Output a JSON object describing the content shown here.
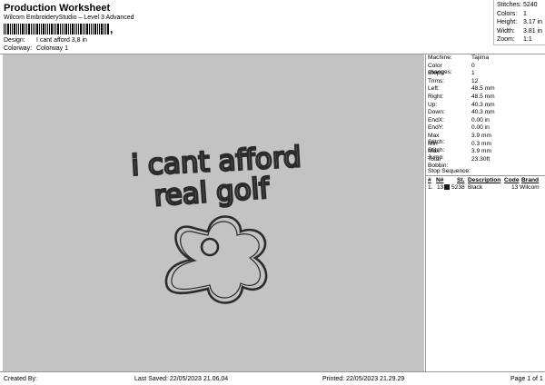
{
  "header": {
    "title": "Production Worksheet",
    "subtitle": "Wilcom EmbroideryStudio – Level 3 Advanced",
    "barcode_suffix": ","
  },
  "meta": [
    {
      "label": "Design:",
      "value": "I cant afford 3,8 in"
    },
    {
      "label": "Colorway:",
      "value": "Colorway 1"
    }
  ],
  "stats": [
    {
      "label": "Stitches:",
      "value": "5240"
    },
    {
      "label": "Colors:",
      "value": "1"
    },
    {
      "label": "Height:",
      "value": "3.17 in"
    },
    {
      "label": "Width:",
      "value": "3.81 in"
    },
    {
      "label": "Zoom:",
      "value": "1:1"
    }
  ],
  "machine": [
    {
      "label": "Machine:",
      "value": "Tajima"
    },
    {
      "label": "Color changes:",
      "value": "0"
    },
    {
      "label": "Stops:",
      "value": "1"
    },
    {
      "label": "Trims:",
      "value": "12"
    },
    {
      "label": "Left:",
      "value": "48.5 mm"
    },
    {
      "label": "Right:",
      "value": "48.5 mm"
    },
    {
      "label": "Up:",
      "value": "40.3 mm"
    },
    {
      "label": "Down:",
      "value": "40.3 mm"
    },
    {
      "label": "EndX:",
      "value": "0.00 in"
    },
    {
      "label": "EndY:",
      "value": "0.00 in"
    },
    {
      "label": "Max Stitch:",
      "value": "3.9 mm"
    },
    {
      "label": "Min Stitch:",
      "value": "0.3 mm"
    },
    {
      "label": "Max Jump:",
      "value": "3.9 mm"
    },
    {
      "label": "Total Bobbin:",
      "value": "23.30ft"
    }
  ],
  "stop_sequence": {
    "heading": "Stop Sequence:",
    "columns": [
      "#",
      "N#",
      "St.",
      "Description",
      "Code",
      "Brand"
    ],
    "rows": [
      {
        "num": "1.",
        "n": "13",
        "st": "5238",
        "description": "Black",
        "code": "13",
        "brand": "Wilcom",
        "color": "#1a1a1a"
      }
    ]
  },
  "design": {
    "line1": "i cant afford",
    "line2": "real golf",
    "background": "#c3c3c3",
    "ink": "#2b2b2b"
  },
  "footer": {
    "created": "Created By:",
    "saved": "Last Saved: 22/05/2023 21.06.04",
    "printed": "Printed: 22/05/2023 21.29.29",
    "page": "Page 1 of 1"
  }
}
